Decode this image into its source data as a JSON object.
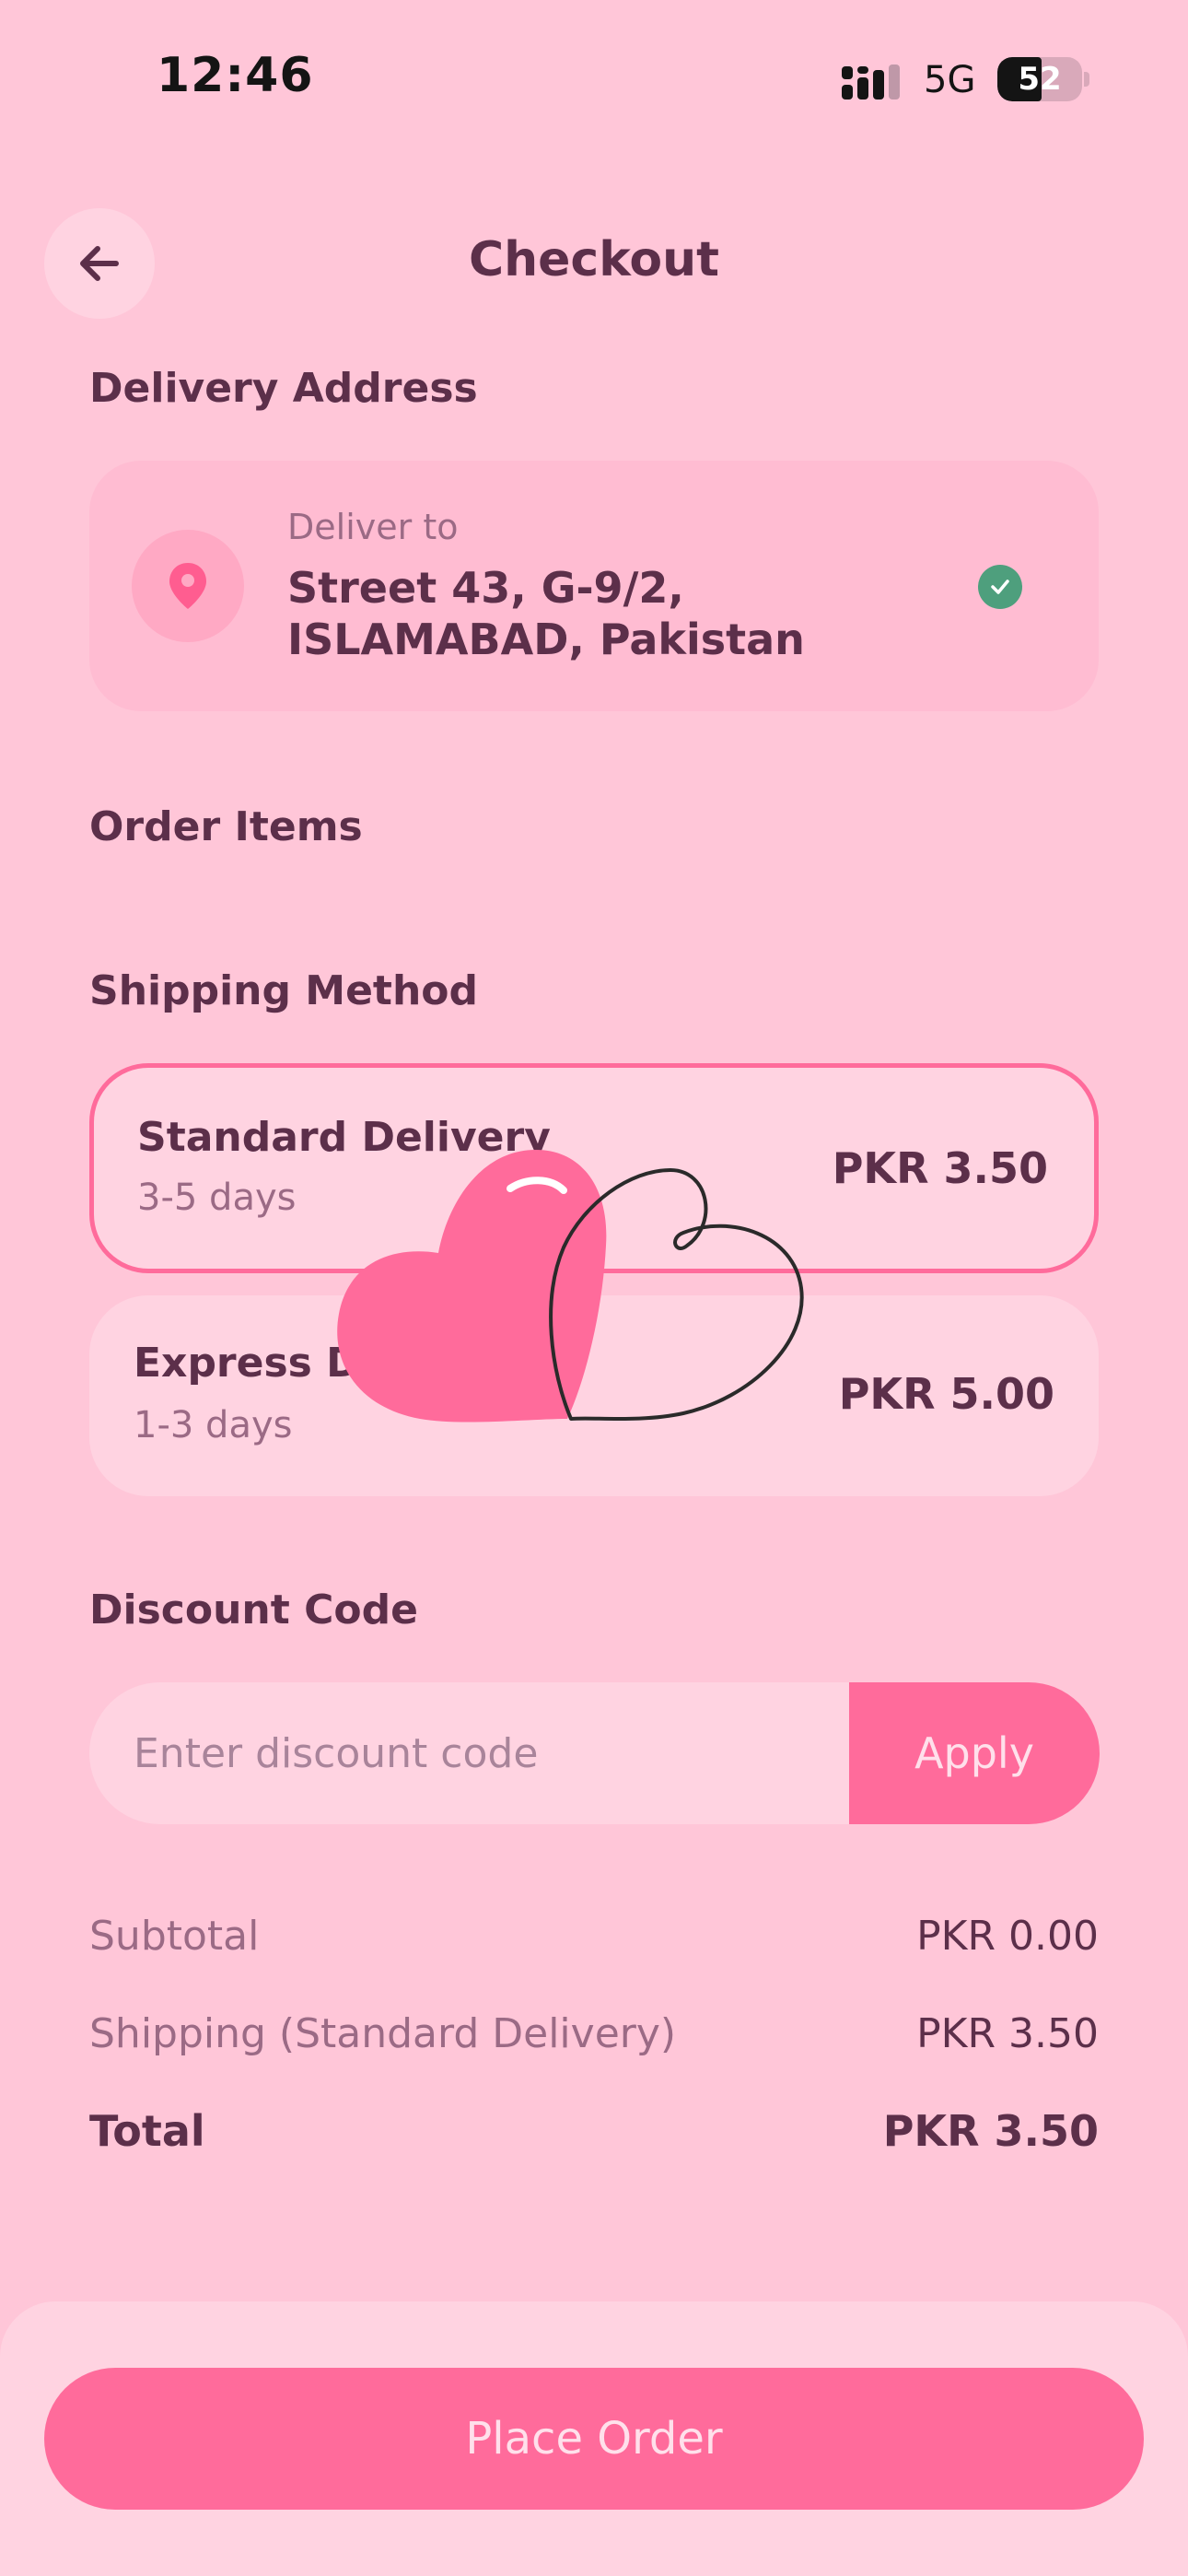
{
  "status_bar": {
    "time": "12:46",
    "network": "5G",
    "battery_level": "52"
  },
  "header": {
    "back_icon": "arrow-left-icon",
    "title": "Checkout"
  },
  "delivery_address": {
    "section_title": "Delivery Address",
    "label": "Deliver to",
    "address": "Street 43, G-9/2, ISLAMABAD, Pakistan",
    "pin_icon": "map-pin-icon",
    "verified_icon": "check-circle-icon"
  },
  "order_items": {
    "section_title": "Order Items"
  },
  "shipping": {
    "section_title": "Shipping Method",
    "options": [
      {
        "name": "Standard Delivery",
        "days": "3-5 days",
        "price": "PKR 3.50",
        "selected": true
      },
      {
        "name": "Express Delivery",
        "days": "1-3 days",
        "price": "PKR 5.00",
        "selected": false
      }
    ]
  },
  "discount": {
    "section_title": "Discount Code",
    "placeholder": "Enter discount code",
    "value": "",
    "apply_label": "Apply"
  },
  "summary": {
    "subtotal_label": "Subtotal",
    "subtotal_value": "PKR 0.00",
    "shipping_label": "Shipping (Standard Delivery)",
    "shipping_value": "PKR 3.50",
    "total_label": "Total",
    "total_value": "PKR 3.50"
  },
  "footer": {
    "place_order_label": "Place Order"
  },
  "colors": {
    "background": "#ffc6d8",
    "accent": "#ff6b9b",
    "text_primary": "#5c2f4a",
    "text_secondary": "#9b6a85",
    "success": "#4e9f7d"
  }
}
